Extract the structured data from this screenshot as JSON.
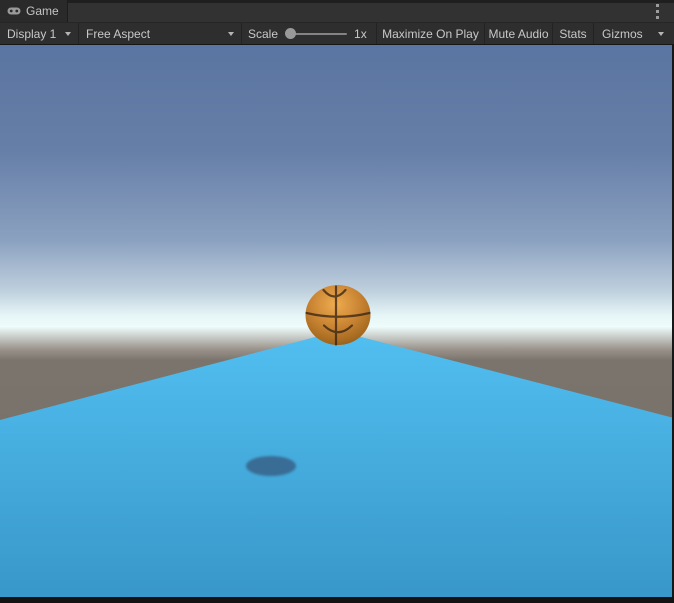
{
  "tab_bar": {
    "game_tab_label": "Game"
  },
  "toolbar": {
    "display_label": "Display 1",
    "aspect_label": "Free Aspect",
    "scale_label": "Scale",
    "scale_value": "1x",
    "buttons": [
      {
        "label": "Maximize On Play"
      },
      {
        "label": "Mute Audio"
      },
      {
        "label": "Stats"
      },
      {
        "label": "Gizmos"
      }
    ]
  },
  "scene": {
    "objects": [
      "basketball",
      "blue-platform",
      "ground-plane",
      "ball-shadow",
      "sky"
    ],
    "colors": {
      "sky_top": "#5a75a1",
      "sky_horizon": "#eefcfb",
      "ground": "#7b746c",
      "road_far": "#52bff1",
      "road_near": "#3896c8",
      "ball_highlight": "#efac4f",
      "ball": "#c98433",
      "shadow": "#39688f"
    }
  }
}
